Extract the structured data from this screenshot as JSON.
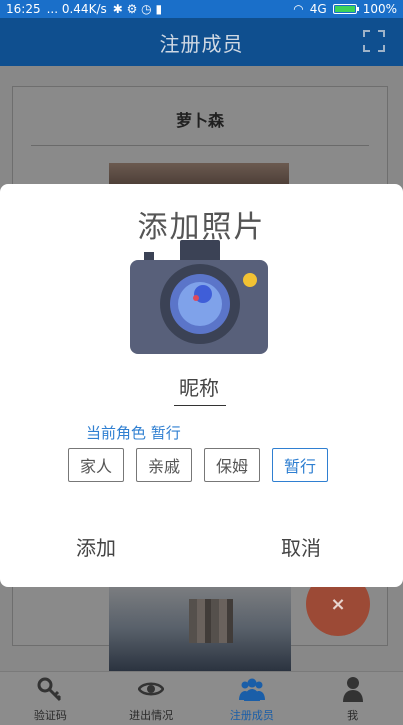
{
  "statusbar": {
    "time": "16:25",
    "speed": "... 0.44K/s",
    "network": "4G",
    "battery": "100%",
    "battery_level": 1.0
  },
  "header": {
    "title": "注册成员"
  },
  "card": {
    "name": "萝卜森"
  },
  "fab": {
    "label": "×"
  },
  "dialog": {
    "title": "添加照片",
    "nickname_label": "昵称",
    "role_prefix": "当前角色",
    "role_current": "暂行",
    "roles": [
      "家人",
      "亲戚",
      "保姆",
      "暂行"
    ],
    "selected_role_index": 3,
    "add_label": "添加",
    "cancel_label": "取消"
  },
  "nav": {
    "items": [
      {
        "label": "验证码",
        "icon": "key-icon"
      },
      {
        "label": "进出情况",
        "icon": "eye-icon"
      },
      {
        "label": "注册成员",
        "icon": "users-icon"
      },
      {
        "label": "我",
        "icon": "person-icon"
      }
    ],
    "active_index": 2
  },
  "colors": {
    "accent": "#2f7fd1",
    "appbar": "#0f4f8f",
    "fab": "#e05a3a"
  }
}
